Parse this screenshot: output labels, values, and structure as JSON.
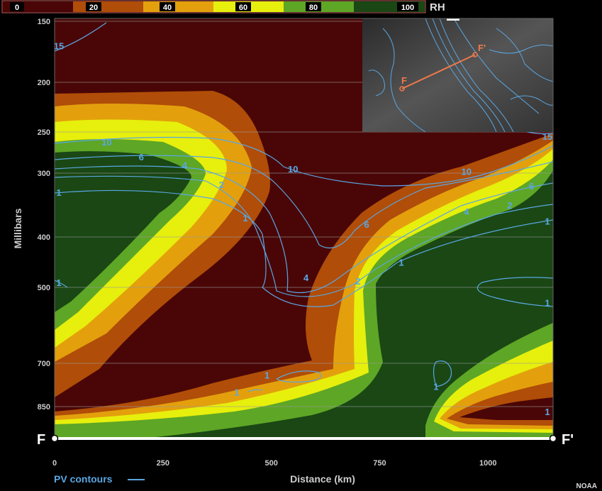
{
  "chart_data": {
    "type": "heatmap",
    "title": "",
    "xlabel": "Distance (km)",
    "ylabel": "Millibars",
    "xlim": [
      0,
      1150
    ],
    "x_ticks": [
      0,
      250,
      500,
      750,
      1000
    ],
    "y_ticks": [
      150,
      200,
      250,
      300,
      400,
      500,
      700,
      850
    ],
    "legend": {
      "label": "RH",
      "position": "top-left",
      "stops": [
        0,
        20,
        40,
        60,
        80,
        100
      ],
      "colors": [
        "#4a0606",
        "#b04d08",
        "#e3a00c",
        "#e7ef0c",
        "#5ea626",
        "#1a4714"
      ]
    },
    "pv_legend_label": "PV contours",
    "pv_color": "#5aa7e3",
    "pv_contour_labels": [
      {
        "value": "15",
        "x": 0,
        "p": 170
      },
      {
        "value": "10",
        "x": 120,
        "p": 262
      },
      {
        "value": "6",
        "x": 200,
        "p": 280
      },
      {
        "value": "4",
        "x": 300,
        "p": 290
      },
      {
        "value": "2",
        "x": 385,
        "p": 318
      },
      {
        "value": "1",
        "x": 0,
        "p": 330
      },
      {
        "value": "1",
        "x": 440,
        "p": 370
      },
      {
        "value": "10",
        "x": 550,
        "p": 295
      },
      {
        "value": "6",
        "x": 720,
        "p": 380
      },
      {
        "value": "4",
        "x": 580,
        "p": 480
      },
      {
        "value": "2",
        "x": 700,
        "p": 487
      },
      {
        "value": "1",
        "x": 800,
        "p": 450
      },
      {
        "value": "10",
        "x": 950,
        "p": 298
      },
      {
        "value": "6",
        "x": 1100,
        "p": 320
      },
      {
        "value": "4",
        "x": 950,
        "p": 360
      },
      {
        "value": "2",
        "x": 1050,
        "p": 350
      },
      {
        "value": "1",
        "x": 1150,
        "p": 375
      },
      {
        "value": "15",
        "x": 1150,
        "p": 255
      },
      {
        "value": "1",
        "x": 0,
        "p": 490
      },
      {
        "value": "1",
        "x": 1150,
        "p": 540
      },
      {
        "value": "1",
        "x": 490,
        "p": 740
      },
      {
        "value": "1",
        "x": 420,
        "p": 800
      },
      {
        "value": "1",
        "x": 880,
        "p": 780
      },
      {
        "value": "1",
        "x": 1150,
        "p": 870
      }
    ],
    "endpoint_left": "F",
    "endpoint_right": "F'",
    "inset": {
      "label_start": "F",
      "label_end": "F'",
      "line_color": "#f07a4a"
    }
  },
  "credit": "NOAA"
}
